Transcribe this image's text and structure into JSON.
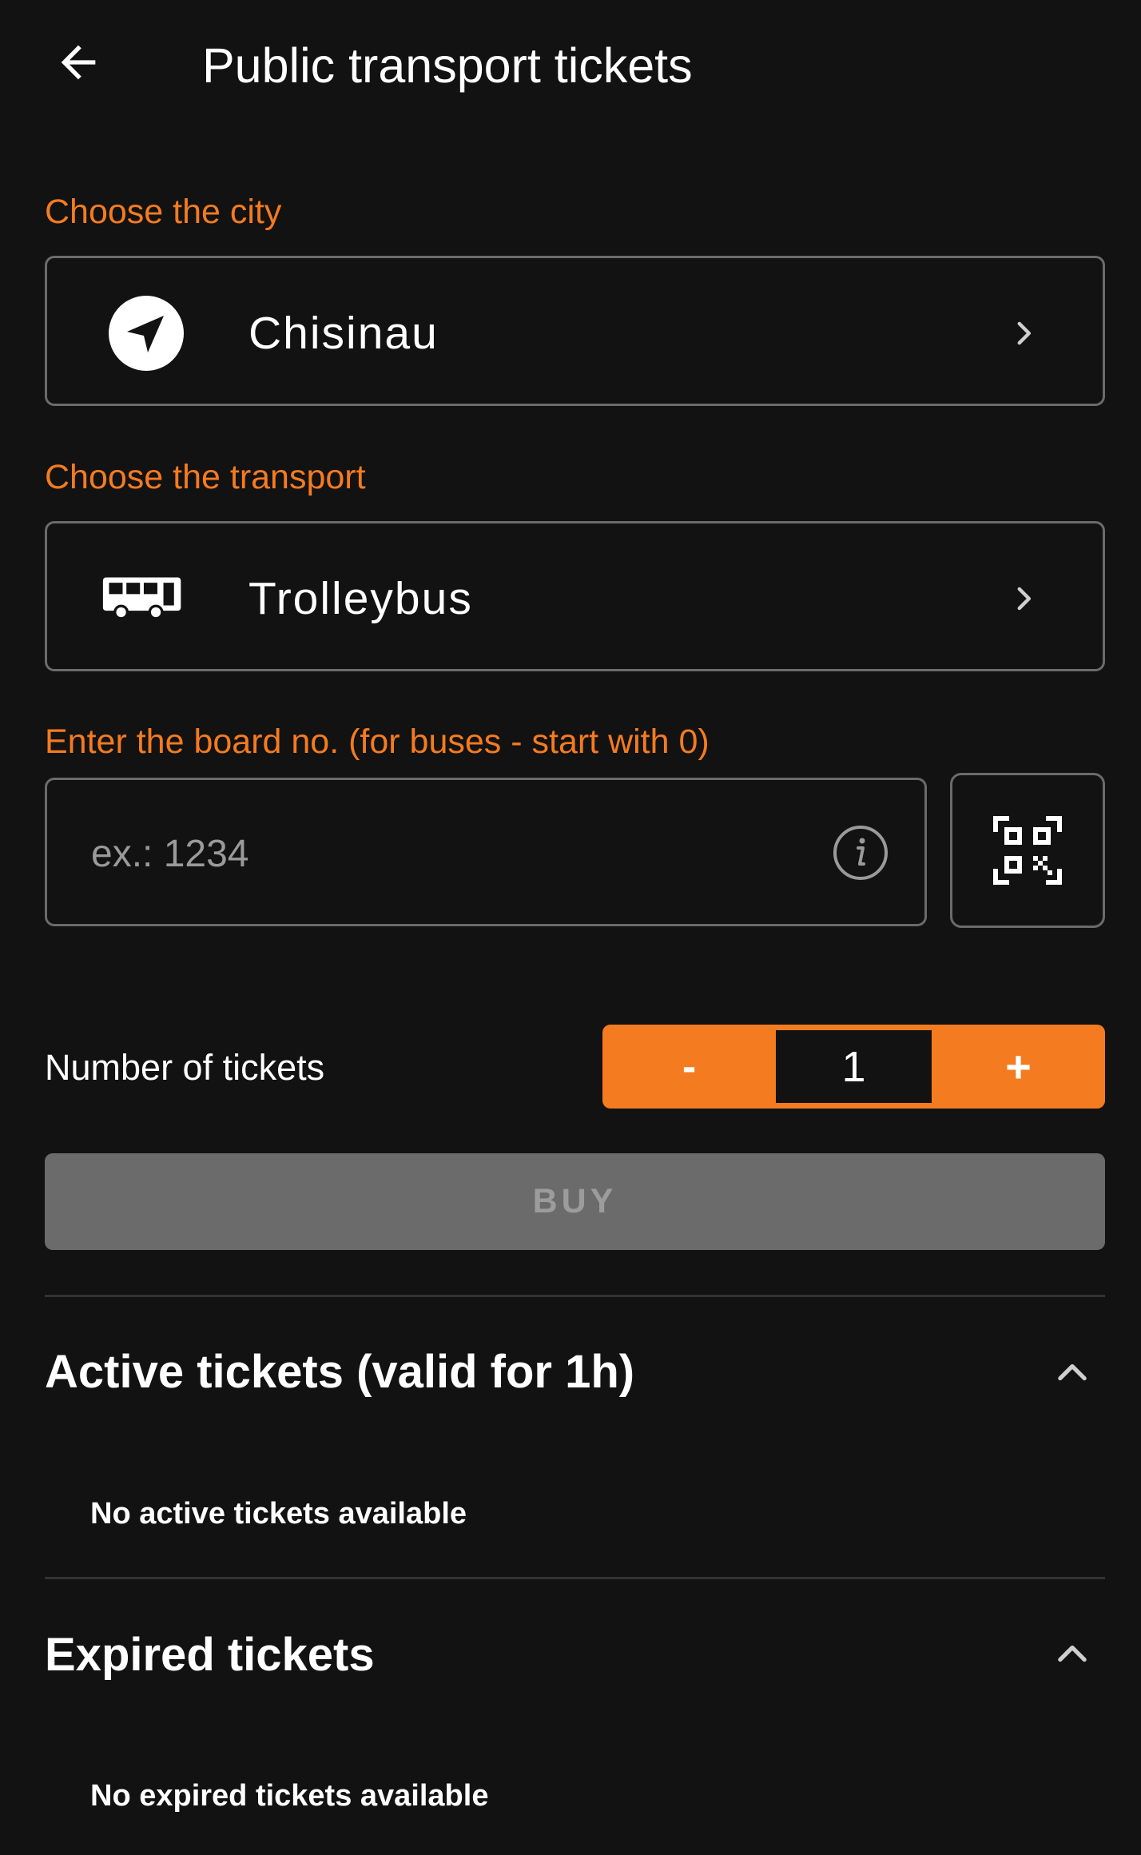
{
  "header": {
    "title": "Public transport tickets",
    "back_icon": "arrow-left-icon"
  },
  "city": {
    "label": "Choose the city",
    "value": "Chisinau",
    "icon": "navigation-arrow-icon"
  },
  "transport": {
    "label": "Choose the transport",
    "value": "Trolleybus",
    "icon": "bus-icon"
  },
  "board": {
    "label": "Enter the board no. (for buses - start with 0)",
    "placeholder": "ex.: 1234",
    "value": "",
    "info_icon": "info-icon",
    "qr_icon": "qr-code-icon"
  },
  "tickets": {
    "label": "Number of tickets",
    "minus_label": "-",
    "count": "1",
    "plus_label": "+"
  },
  "buy": {
    "label": "BUY"
  },
  "active_section": {
    "title": "Active tickets (valid for 1h)",
    "empty_text": "No active tickets available"
  },
  "expired_section": {
    "title": "Expired tickets",
    "empty_text": "No expired tickets available"
  },
  "colors": {
    "background": "#121212",
    "accent": "#f47b20",
    "border": "#6b6b6b",
    "button_disabled": "#6b6b6b"
  }
}
